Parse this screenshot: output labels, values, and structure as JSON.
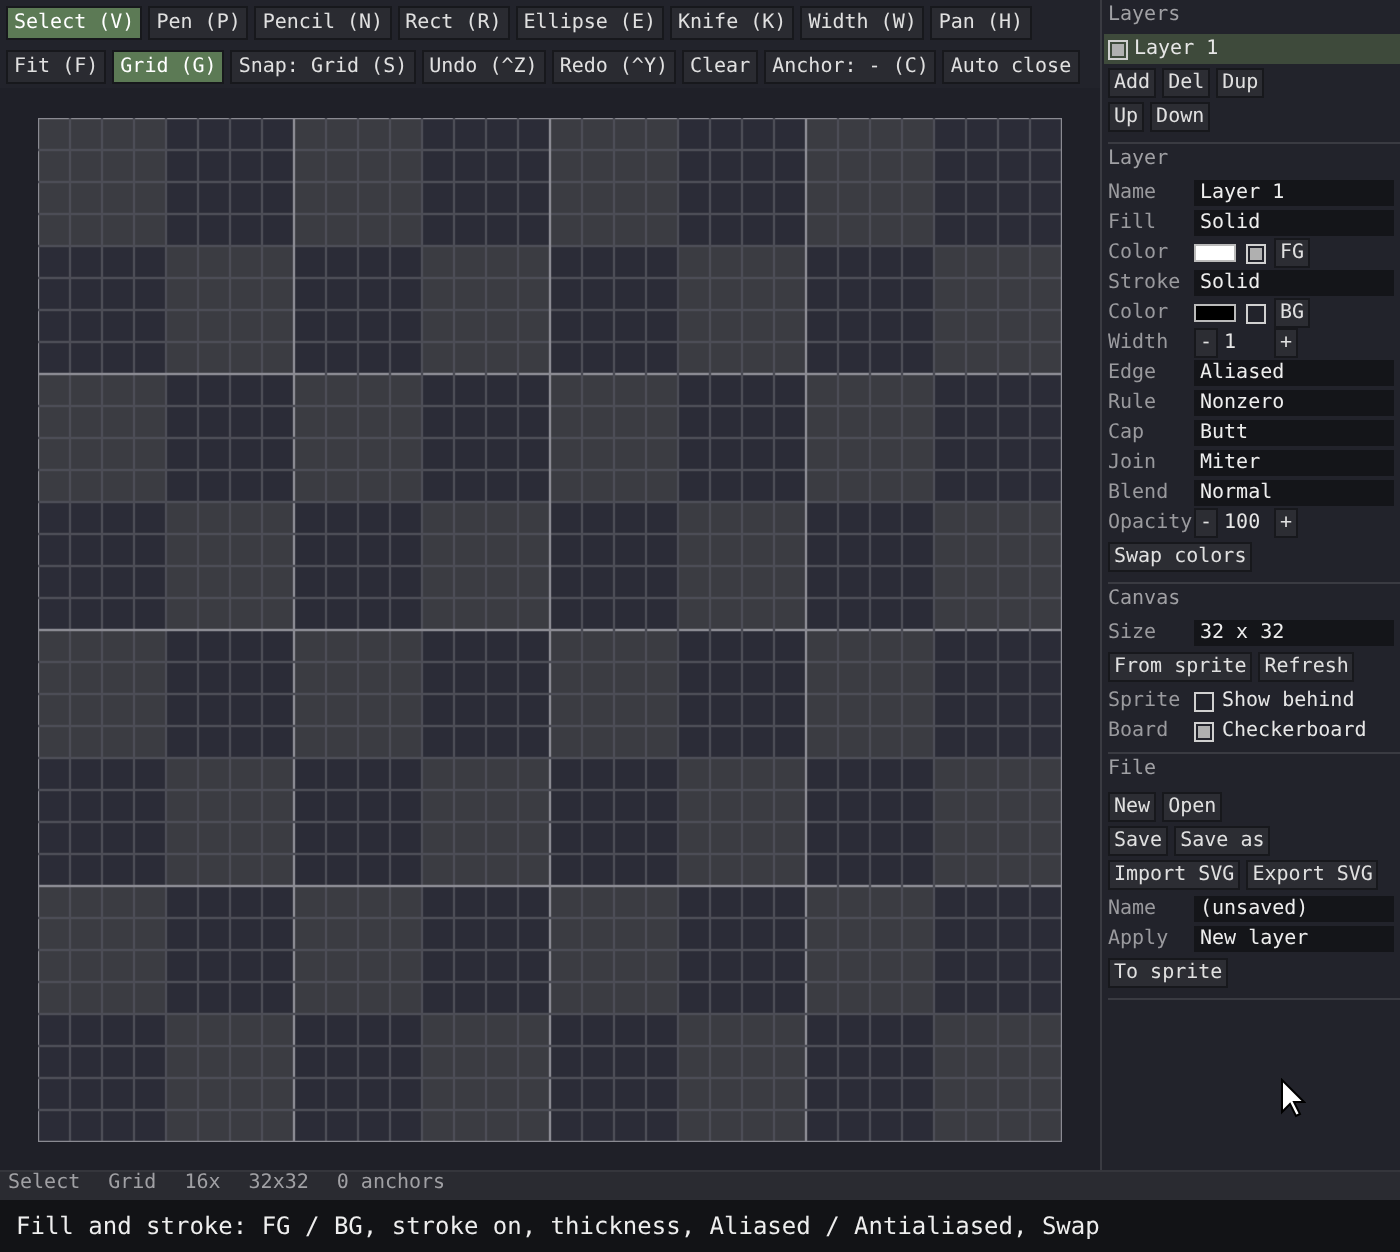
{
  "toolbar": [
    [
      {
        "label": "Select (V)",
        "selected": true
      },
      {
        "label": "Pen (P)",
        "selected": false
      },
      {
        "label": "Pencil (N)",
        "selected": false
      },
      {
        "label": "Rect (R)",
        "selected": false
      },
      {
        "label": "Ellipse (E)",
        "selected": false
      },
      {
        "label": "Knife (K)",
        "selected": false
      },
      {
        "label": "Width (W)",
        "selected": false
      },
      {
        "label": "Pan (H)",
        "selected": false
      }
    ],
    [
      {
        "label": "Fit (F)",
        "selected": false
      },
      {
        "label": "Grid (G)",
        "selected": true
      },
      {
        "label": "Snap: Grid (S)",
        "selected": false
      },
      {
        "label": "Undo (^Z)",
        "selected": false
      },
      {
        "label": "Redo (^Y)",
        "selected": false
      },
      {
        "label": "Clear",
        "selected": false
      },
      {
        "label": "Anchor: - (C)",
        "selected": false
      },
      {
        "label": "Auto close",
        "selected": false
      }
    ]
  ],
  "layers": {
    "title": "Layers",
    "items": [
      {
        "name": "Layer 1",
        "visible": true,
        "selected": true
      }
    ],
    "button_rows": [
      [
        "Add",
        "Del",
        "Dup"
      ],
      [
        "Up",
        "Down"
      ]
    ]
  },
  "sections": [
    {
      "title": "Layer",
      "rows": [
        {
          "kind": "field",
          "label": "Name",
          "value": "Layer 1"
        },
        {
          "kind": "field",
          "label": "Fill",
          "value": "Solid"
        },
        {
          "kind": "color",
          "label": "Color",
          "color": "#ffffff",
          "checked": true,
          "button": "FG"
        },
        {
          "kind": "field",
          "label": "Stroke",
          "value": "Solid"
        },
        {
          "kind": "color",
          "label": "Color",
          "color": "#000000",
          "checked": false,
          "button": "BG"
        },
        {
          "kind": "stepper",
          "label": "Width",
          "minus": "-",
          "value": "1",
          "plus": "+"
        },
        {
          "kind": "field",
          "label": "Edge",
          "value": "Aliased"
        },
        {
          "kind": "field",
          "label": "Rule",
          "value": "Nonzero"
        },
        {
          "kind": "field",
          "label": "Cap",
          "value": "Butt"
        },
        {
          "kind": "field",
          "label": "Join",
          "value": "Miter"
        },
        {
          "kind": "field",
          "label": "Blend",
          "value": "Normal"
        },
        {
          "kind": "stepper",
          "label": "Opacity",
          "minus": "-",
          "value": "100",
          "plus": "+"
        },
        {
          "kind": "buttons",
          "buttons": [
            "Swap colors"
          ]
        }
      ]
    },
    {
      "title": "Canvas",
      "rows": [
        {
          "kind": "field",
          "label": "Size",
          "value": "32 x 32"
        },
        {
          "kind": "buttons",
          "buttons": [
            "From sprite",
            "Refresh"
          ]
        },
        {
          "kind": "check",
          "label": "Sprite",
          "text": "Show behind",
          "checked": false
        },
        {
          "kind": "check",
          "label": "Board",
          "text": "Checkerboard",
          "checked": true
        }
      ]
    },
    {
      "title": "File",
      "rows": [
        {
          "kind": "buttons",
          "buttons": [
            "New",
            "Open"
          ]
        },
        {
          "kind": "buttons",
          "buttons": [
            "Save",
            "Save as"
          ]
        },
        {
          "kind": "buttons",
          "buttons": [
            "Import SVG",
            "Export SVG"
          ]
        },
        {
          "kind": "field",
          "label": "Name",
          "value": "(unsaved)"
        },
        {
          "kind": "field",
          "label": "Apply",
          "value": "New layer"
        },
        {
          "kind": "buttons",
          "buttons": [
            "To sprite"
          ]
        }
      ]
    }
  ],
  "status_bar": [
    "Select",
    "Grid",
    "16x",
    "32x32",
    "0 anchors"
  ],
  "hint": "Fill and stroke: FG / BG, stroke on, thickness, Aliased / Antialiased, Swap"
}
